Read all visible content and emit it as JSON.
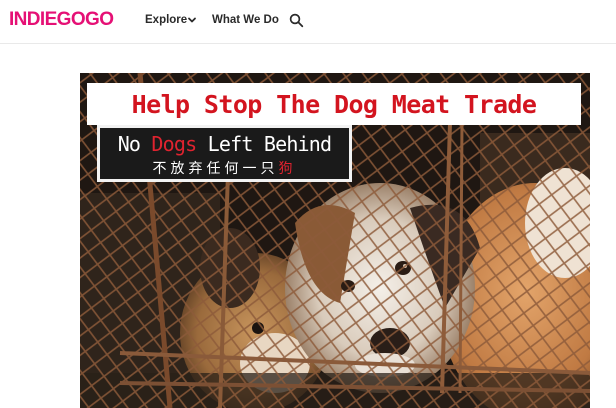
{
  "header": {
    "logo": "INDIEGOGO",
    "nav": {
      "explore": "Explore",
      "what_we_do": "What We Do"
    },
    "icons": {
      "explore_dropdown": "chevron-down-icon",
      "search": "search-icon"
    }
  },
  "hero": {
    "title": "Help Stop The Dog Meat Trade",
    "subtitle_parts": {
      "before": "No ",
      "highlight": "Dogs",
      "after": " Left Behind"
    },
    "chinese_parts": {
      "before": "不放弃任何一只",
      "highlight": "狗"
    }
  },
  "colors": {
    "brand": "#e51075",
    "title_red": "#d3141f",
    "subtitle_red": "#e0232f",
    "nav_text": "#2a2a2a"
  }
}
